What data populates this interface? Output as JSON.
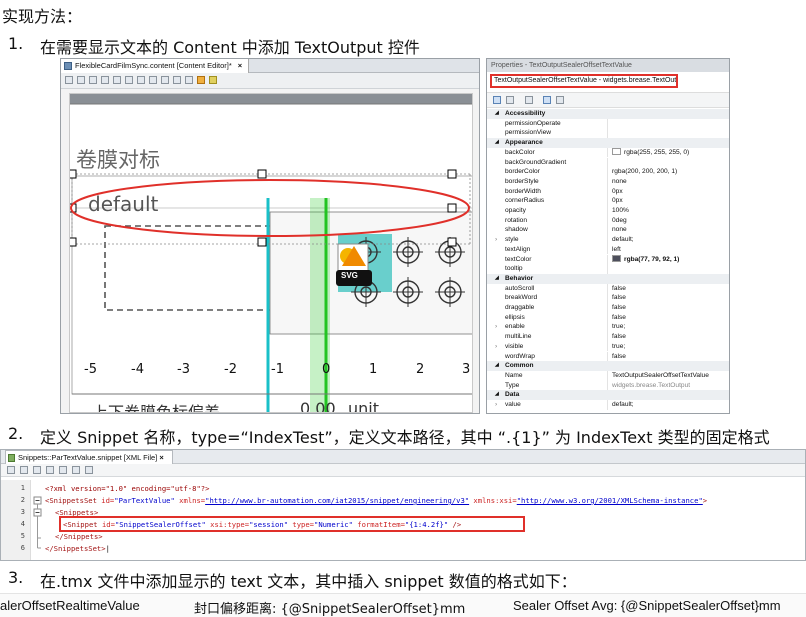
{
  "heading": "实现方法：",
  "steps": [
    {
      "num": "1.",
      "text": "在需要显示文本的 Content 中添加 TextOutput 控件"
    },
    {
      "num": "2.",
      "text": "定义 Snippet 名称，type=“IndexTest”，定义文本路径，其中 “.{1}” 为 IndexText 类型的固定格式"
    },
    {
      "num": "3.",
      "text": "在.tmx 文件中添加显示的 text 文本，其中插入 snippet 数值的格式如下："
    }
  ],
  "editor": {
    "tab_label": "FlexibleCardFilmSync.content [Content Editor]*",
    "tab_close": "×",
    "canvas_title": "卷膜对标",
    "text_output_value": "default",
    "svg_label": "SVG",
    "axis_ticks": [
      "-5",
      "-4",
      "-3",
      "-2",
      "-1",
      "0",
      "1",
      "2",
      "3"
    ],
    "bottom_label": "上下卷膜色标偏差",
    "bottom_value": "0.00",
    "bottom_unit": "unit"
  },
  "properties": {
    "title": "Properties - TextOutputSealerOffsetTextValue",
    "selected": "TextOutputSealerOffsetTextValue - widgets.brease.TextOutput",
    "rows": [
      {
        "cat": true,
        "name": "Accessibility"
      },
      {
        "name": "permissionOperate",
        "value": ""
      },
      {
        "name": "permissionView",
        "value": ""
      },
      {
        "cat": true,
        "name": "Appearance"
      },
      {
        "name": "backColor",
        "value": "rgba(255, 255, 255, 0)",
        "swatch": "#ffffff"
      },
      {
        "name": "backGroundGradient",
        "value": ""
      },
      {
        "name": "borderColor",
        "value": "rgba(200, 200, 200, 1)"
      },
      {
        "name": "borderStyle",
        "value": "none"
      },
      {
        "name": "borderWidth",
        "value": "0px"
      },
      {
        "name": "cornerRadius",
        "value": "0px"
      },
      {
        "name": "opacity",
        "value": "100%"
      },
      {
        "name": "rotation",
        "value": "0deg"
      },
      {
        "name": "shadow",
        "value": "none"
      },
      {
        "name": "style",
        "value": "default;",
        "expand": true
      },
      {
        "name": "textAlign",
        "value": "left"
      },
      {
        "name": "textColor",
        "value": "rgba(77, 79, 92, 1)",
        "swatch": "#4d4f5c",
        "bold": true
      },
      {
        "name": "tooltip",
        "value": ""
      },
      {
        "cat": true,
        "name": "Behavior"
      },
      {
        "name": "autoScroll",
        "value": "false"
      },
      {
        "name": "breakWord",
        "value": "false"
      },
      {
        "name": "draggable",
        "value": "false"
      },
      {
        "name": "ellipsis",
        "value": "false"
      },
      {
        "name": "enable",
        "value": "true;",
        "expand": true
      },
      {
        "name": "multiLine",
        "value": "false"
      },
      {
        "name": "visible",
        "value": "true;",
        "expand": true
      },
      {
        "name": "wordWrap",
        "value": "false"
      },
      {
        "cat": true,
        "name": "Common"
      },
      {
        "name": "Name",
        "value": "TextOutputSealerOffsetTextValue"
      },
      {
        "name": "Type",
        "value": "widgets.brease.TextOutput",
        "muted": true
      },
      {
        "cat": true,
        "name": "Data"
      },
      {
        "name": "value",
        "value": "default;",
        "expand": true
      }
    ]
  },
  "xml": {
    "tab_label": "Snippets::ParTextValue.snippet [XML File]",
    "tab_close": "×",
    "line_numbers": [
      "1",
      "2",
      "3",
      "4",
      "5",
      "6"
    ],
    "line1": "<?xml version=\"1.0\" encoding=\"utf-8\"?>",
    "line2_open": "<SnippetsSet",
    "line2_id_attr": " id=",
    "line2_id_val": "\"ParTextValue\"",
    "line2_xmlns_attr": " xmlns=",
    "line2_xmlns_val": "\"http://www.br-automation.com/iat2015/snippet/engineering/v3\"",
    "line2_xsi_attr": " xmlns:xsi=",
    "line2_xsi_val": "\"http://www.w3.org/2001/XMLSchema-instance\"",
    "line2_close": ">",
    "line3": "<Snippets>",
    "line4_open": "<Snippet",
    "line4_id_attr": " id=",
    "line4_id_val": "\"SnippetSealerOffset\"",
    "line4_type_attr": " xsi:type=",
    "line4_type_val": "\"session\"",
    "line4_t2_attr": " type=",
    "line4_t2_val": "\"Numeric\"",
    "line4_fmt_attr": " formatItem=",
    "line4_fmt_val": "\"{1:4.2f}\"",
    "line4_close": " />",
    "line5": "</Snippets>",
    "line6": "</SnippetsSet>",
    "cursor": "|"
  },
  "tmx": {
    "col1": "alerOffsetRealtimeValue",
    "col2": "封口偏移距离: {@SnippetSealerOffset}mm",
    "col3": "Sealer Offset Avg: {@SnippetSealerOffset}mm"
  },
  "colors": {
    "highlight": "#e0302a",
    "guide_cyan": "#19c0c8",
    "guide_green": "#33cc33"
  }
}
